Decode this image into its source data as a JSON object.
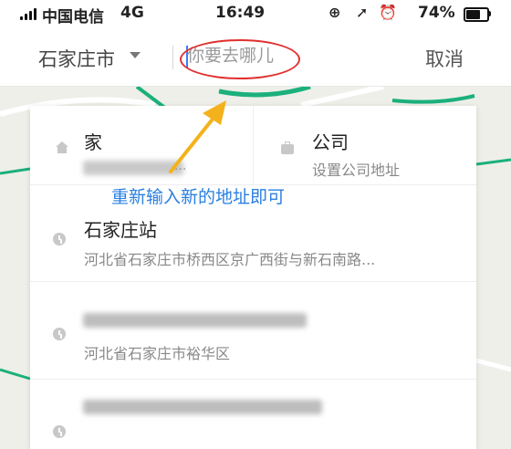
{
  "status_bar": {
    "carrier": "中国电信",
    "network": "4G",
    "time": "16:49",
    "battery_percent": "74%",
    "battery_level": 0.74,
    "icons": [
      "lock-rotation-icon",
      "location-arrow-icon",
      "alarm-icon",
      "battery-icon"
    ]
  },
  "search": {
    "city": "石家庄市",
    "placeholder": "你要去哪儿",
    "cancel_label": "取消"
  },
  "quick_access": {
    "home": {
      "label": "家"
    },
    "work": {
      "label": "公司",
      "subtitle": "设置公司地址"
    }
  },
  "suggestions": [
    {
      "title": "石家庄站",
      "address": "河北省石家庄市桥西区京广西街与新石南路..."
    },
    {
      "title": "",
      "address": "河北省石家庄市裕华区"
    },
    {
      "title": "",
      "address": ""
    }
  ],
  "annotation": {
    "text": "重新输入新的地址即可",
    "color": "#2a7fe2",
    "arrow_color": "#f3b21b",
    "ellipse_color": "#e0302f"
  },
  "colors": {
    "accent": "#3b7cff",
    "map_road": "#1bb07c",
    "map_bg": "#eeefe9"
  }
}
